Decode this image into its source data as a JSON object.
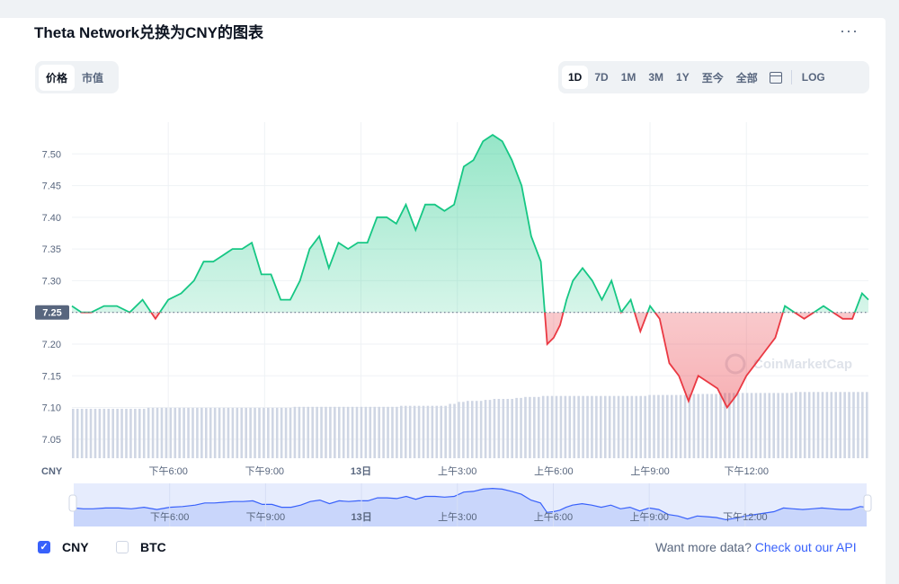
{
  "title": "Theta Network兑换为CNY的图表",
  "more_label": "···",
  "toggle": {
    "options": [
      "价格",
      "市值"
    ],
    "active": 0
  },
  "ranges": {
    "options": [
      "1D",
      "7D",
      "1M",
      "3M",
      "1Y",
      "至今",
      "全部"
    ],
    "active": 0,
    "log_label": "LOG",
    "calendar_icon": "calendar-icon"
  },
  "colors": {
    "up": "#16c784",
    "down": "#ea3943",
    "navigator": "#3861fb",
    "volume": "#cfd6e4",
    "grid": "#eff2f5"
  },
  "legend": {
    "cny": "CNY",
    "btc": "BTC",
    "cny_checked": true,
    "btc_checked": false
  },
  "footer": {
    "text": "Want more data?",
    "link": "Check out our API"
  },
  "watermark": "CoinMarketCap",
  "chart_data": {
    "type": "line",
    "ylabel_unit": "CNY",
    "baseline": 7.25,
    "baseline_label": "7.25",
    "ylim": [
      7.02,
      7.55
    ],
    "y_ticks": [
      7.05,
      7.1,
      7.15,
      7.2,
      7.25,
      7.3,
      7.35,
      7.4,
      7.45,
      7.5
    ],
    "y_tick_labels": [
      "7.05",
      "7.10",
      "7.15",
      "7.20",
      "7.25",
      "7.30",
      "7.35",
      "7.40",
      "7.45",
      "7.50"
    ],
    "x_range": [
      15.0,
      39.8
    ],
    "x_ticks": [
      18,
      21,
      24,
      27,
      30,
      33,
      36
    ],
    "x_tick_labels": [
      "下午6:00",
      "下午9:00",
      "13日",
      "上午3:00",
      "上午6:00",
      "上午9:00",
      "下午12:00"
    ],
    "x_unit": "hour",
    "series": [
      {
        "x": [
          15.0,
          15.3,
          15.6,
          16.0,
          16.4,
          16.8,
          17.2,
          17.6,
          18.0,
          18.4,
          18.8,
          19.1,
          19.4,
          19.7,
          20.0,
          20.3,
          20.6,
          20.9,
          21.2,
          21.5,
          21.8,
          22.1,
          22.4,
          22.7,
          23.0,
          23.3,
          23.6,
          23.9,
          24.2,
          24.5,
          24.8,
          25.1,
          25.4,
          25.7,
          26.0,
          26.3,
          26.6,
          26.9,
          27.2,
          27.5,
          27.8,
          28.1,
          28.4,
          28.7,
          29.0,
          29.3,
          29.6,
          29.8,
          30.0,
          30.2,
          30.4,
          30.6,
          30.9,
          31.2,
          31.5,
          31.8,
          32.1,
          32.4,
          32.7,
          33.0,
          33.3,
          33.6,
          33.9,
          34.2,
          34.5,
          34.8,
          35.1,
          35.4,
          35.7,
          36.0,
          36.3,
          36.6,
          36.9,
          37.2,
          37.5,
          37.8,
          38.1,
          38.4,
          38.7,
          39.0,
          39.3,
          39.6,
          39.8
        ],
        "y": [
          7.26,
          7.25,
          7.25,
          7.26,
          7.26,
          7.25,
          7.27,
          7.24,
          7.27,
          7.28,
          7.3,
          7.33,
          7.33,
          7.34,
          7.35,
          7.35,
          7.36,
          7.31,
          7.31,
          7.27,
          7.27,
          7.3,
          7.35,
          7.37,
          7.32,
          7.36,
          7.35,
          7.36,
          7.36,
          7.4,
          7.4,
          7.39,
          7.42,
          7.38,
          7.42,
          7.42,
          7.41,
          7.42,
          7.48,
          7.49,
          7.52,
          7.53,
          7.52,
          7.49,
          7.45,
          7.37,
          7.33,
          7.2,
          7.21,
          7.23,
          7.27,
          7.3,
          7.32,
          7.3,
          7.27,
          7.3,
          7.25,
          7.27,
          7.22,
          7.26,
          7.24,
          7.17,
          7.15,
          7.11,
          7.15,
          7.14,
          7.13,
          7.1,
          7.12,
          7.15,
          7.17,
          7.19,
          7.21,
          7.26,
          7.25,
          7.24,
          7.25,
          7.26,
          7.25,
          7.24,
          7.24,
          7.28,
          7.27
        ]
      }
    ],
    "volume_note": "volume bars shown without axis",
    "volume": [
      0.5,
      0.5,
      0.5,
      0.5,
      0.5,
      0.5,
      0.5,
      0.5,
      0.51,
      0.51,
      0.51,
      0.51,
      0.51,
      0.51,
      0.51,
      0.51,
      0.51,
      0.51,
      0.51,
      0.51,
      0.51,
      0.51,
      0.51,
      0.52,
      0.52,
      0.52,
      0.52,
      0.52,
      0.52,
      0.52,
      0.52,
      0.52,
      0.52,
      0.52,
      0.53,
      0.53,
      0.53,
      0.53,
      0.53,
      0.55,
      0.57,
      0.58,
      0.58,
      0.59,
      0.6,
      0.6,
      0.61,
      0.62,
      0.62,
      0.63,
      0.63,
      0.63,
      0.63,
      0.63,
      0.63,
      0.63,
      0.63,
      0.63,
      0.63,
      0.63,
      0.64,
      0.64,
      0.64,
      0.64,
      0.65,
      0.65,
      0.65,
      0.66,
      0.66,
      0.66,
      0.66,
      0.66,
      0.66,
      0.66,
      0.66,
      0.67,
      0.67,
      0.67,
      0.67,
      0.67,
      0.67,
      0.67,
      0.67
    ]
  }
}
